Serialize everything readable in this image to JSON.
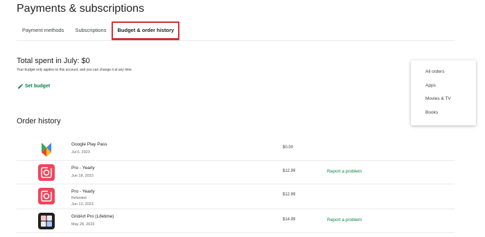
{
  "page": {
    "title": "Payments & subscriptions"
  },
  "tabs": [
    {
      "label": "Payment methods"
    },
    {
      "label": "Subscriptions"
    },
    {
      "label": "Budget & order history"
    }
  ],
  "budget": {
    "total": "Total spent in July: $0",
    "note": "Your budget only applies to this account, and you can change it at any time.",
    "set_budget_label": "Set budget"
  },
  "orders": {
    "heading": "Order history",
    "filter_menu": [
      "All orders",
      "Apps",
      "Movies & TV",
      "Books"
    ],
    "rows": [
      {
        "icon": "google-play-pass-icon",
        "title": "Google Play Pass",
        "subtitle": "",
        "date": "Jul 6, 2023",
        "price": "$0.00",
        "action": ""
      },
      {
        "icon": "pro-yearly-app-icon",
        "title": "Pro - Yearly",
        "subtitle": "",
        "date": "Jun 18, 2023",
        "price": "$12.99",
        "action": "Report a problem"
      },
      {
        "icon": "pro-yearly-app-icon",
        "title": "Pro - Yearly",
        "subtitle": "Refunded",
        "date": "Jun 13, 2023",
        "price": "$12.99",
        "action": ""
      },
      {
        "icon": "gridart-app-icon",
        "title": "GridArt Pro (Lifetime)",
        "subtitle": "",
        "date": "May 28, 2023",
        "price": "$14.99",
        "action": "Report a problem"
      }
    ]
  },
  "colors": {
    "accent_green": "#0b8043",
    "highlight_red": "#d32f2f",
    "app_pink": "#f0445a"
  }
}
